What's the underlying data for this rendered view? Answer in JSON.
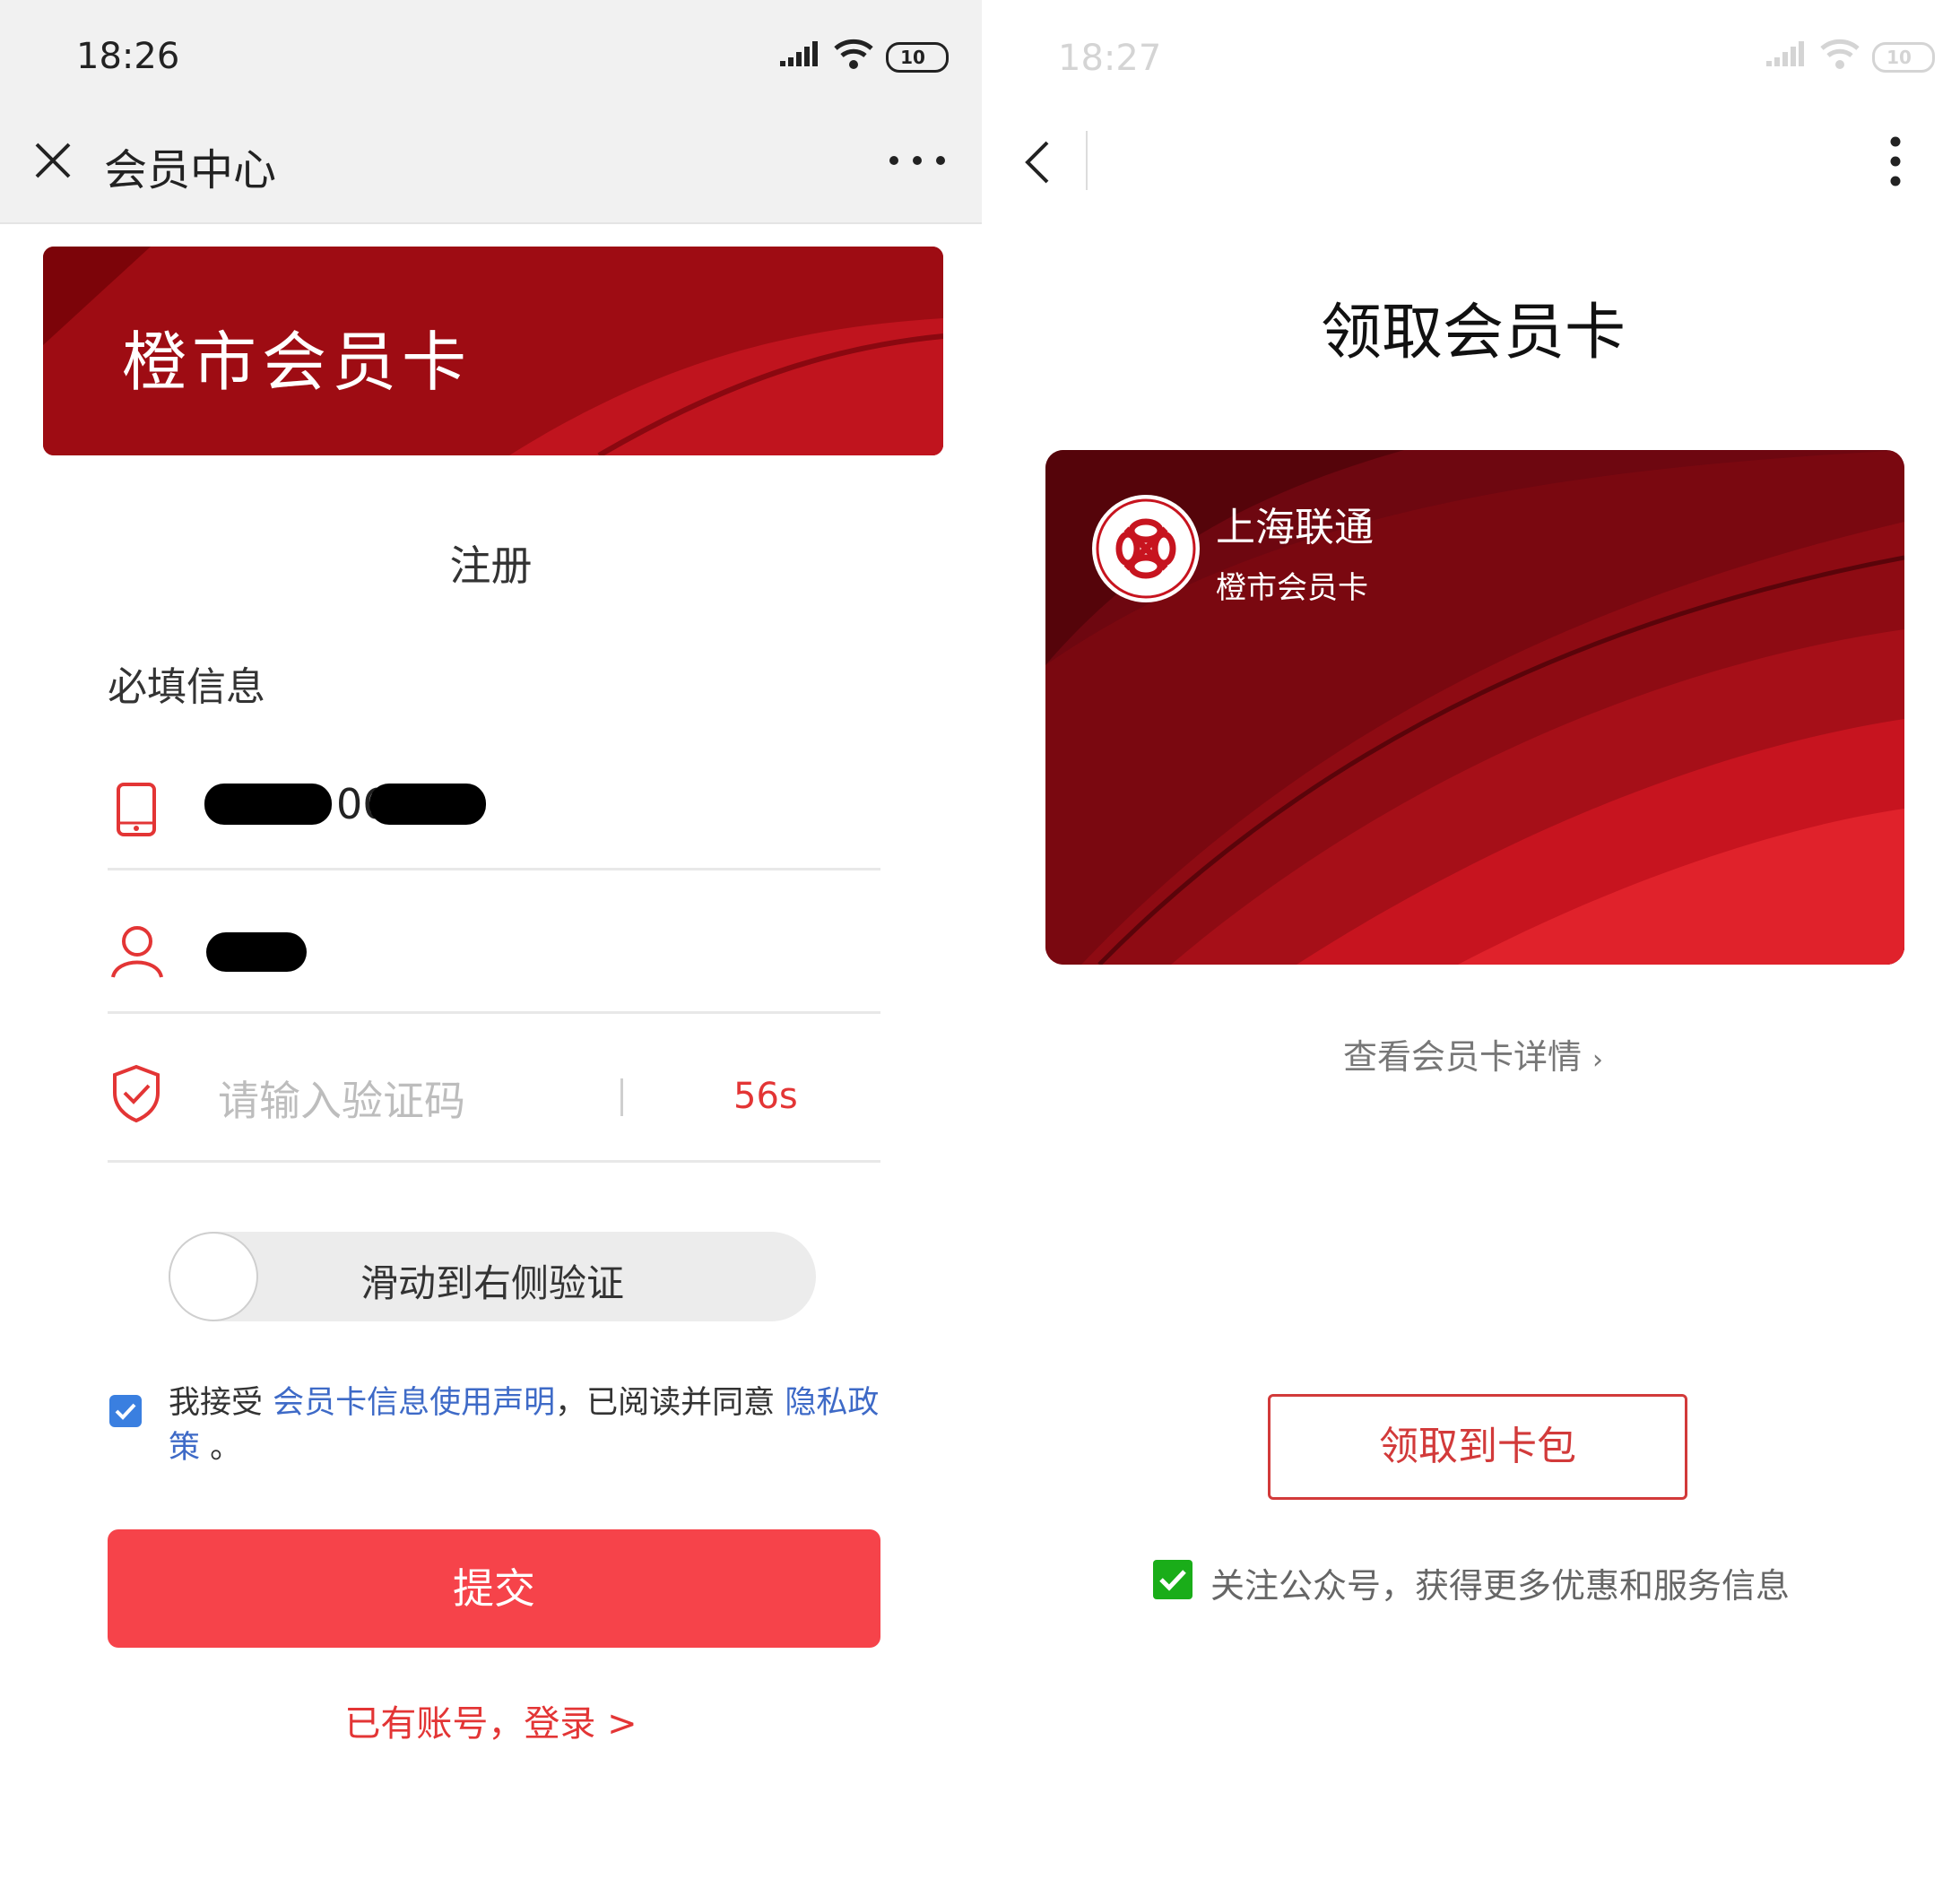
{
  "left": {
    "status": {
      "time": "18:26",
      "battery": "10"
    },
    "header": {
      "title": "会员中心"
    },
    "banner": {
      "title": "橙市会员卡"
    },
    "form": {
      "section_title": "注册",
      "required_label": "必填信息",
      "phone_visible_digits": "06",
      "verify_code_placeholder": "请输入验证码",
      "countdown": "56s",
      "slider_text": "滑动到右侧验证"
    },
    "agreement": {
      "prefix": "我接受",
      "link1": "会员卡信息使用声明",
      "middle": "，已阅读并同意",
      "link2": "隐私政策",
      "suffix": "。",
      "checked": true
    },
    "submit_label": "提交",
    "login_link": "已有账号，登录 >"
  },
  "right": {
    "status": {
      "time": "18:27",
      "battery": "10"
    },
    "page_title": "领取会员卡",
    "card": {
      "issuer": "上海联通",
      "card_name": "橙市会员卡"
    },
    "details_link": "查看会员卡详情",
    "claim_button": "领取到卡包",
    "follow_checkbox": {
      "label": "关注公众号，获得更多优惠和服务信息",
      "checked": true
    }
  },
  "colors": {
    "brand_red": "#f6434a",
    "banner_red": "#9c0a12",
    "link_blue": "#3e6ac7",
    "check_green": "#1aad19"
  }
}
